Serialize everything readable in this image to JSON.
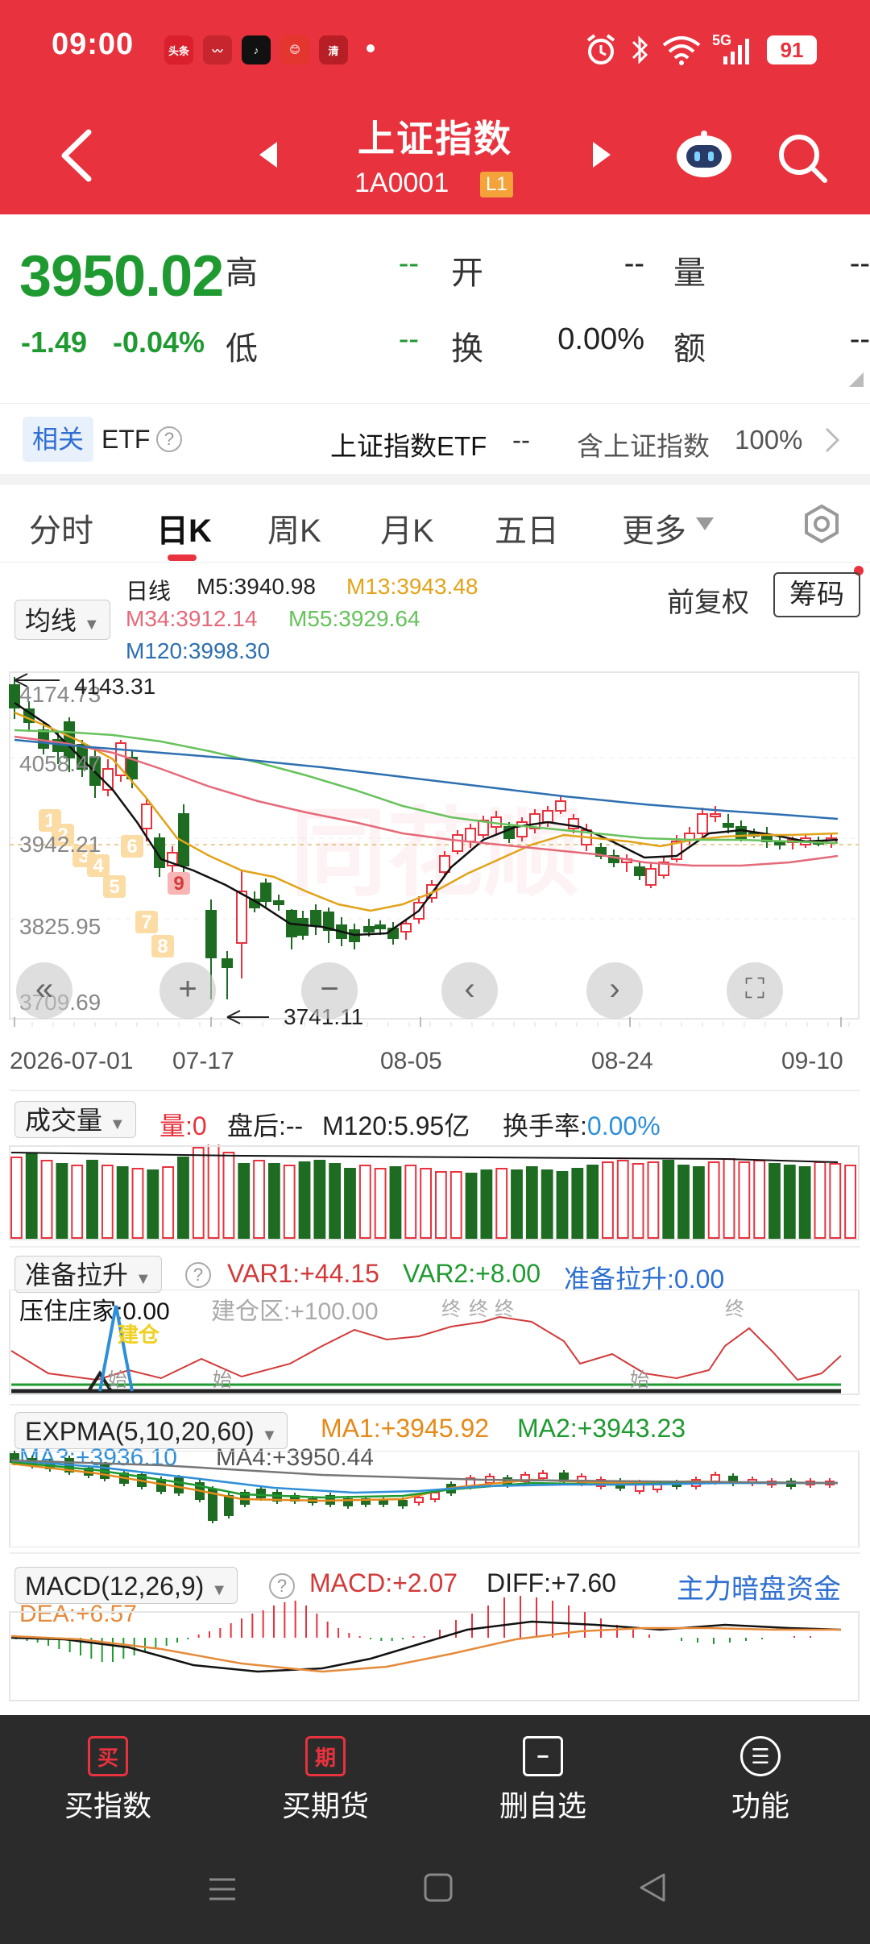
{
  "status_bar": {
    "time": "09:00",
    "battery": "91",
    "network": "5G",
    "app_icons": [
      {
        "label": "头条",
        "color": "#d9202c"
      },
      {
        "label": "〰",
        "color": "#c7262f"
      },
      {
        "label": "♪",
        "color": "#111111"
      },
      {
        "label": "😊",
        "color": "#e5352f"
      },
      {
        "label": "清",
        "color": "#b81e26"
      }
    ]
  },
  "header": {
    "title": "上证指数",
    "code": "1A0001",
    "level_badge": "L1"
  },
  "quote": {
    "price": "3950.02",
    "change": "-1.49",
    "change_pct": "-0.04%",
    "labels": {
      "high": "高",
      "open": "开",
      "volume": "量",
      "low": "低",
      "turnover": "换",
      "amount": "额"
    },
    "high": "--",
    "open": "--",
    "volume": "--",
    "low": "--",
    "turnover": "0.00%",
    "amount": "--"
  },
  "related": {
    "tag": "相关",
    "type": "ETF",
    "etf_name": "上证指数ETF",
    "etf_value": "--",
    "contains": "含上证指数",
    "weight": "100%"
  },
  "tabs": [
    "分时",
    "日K",
    "周K",
    "月K",
    "五日",
    "更多"
  ],
  "active_tab": "日K",
  "kline": {
    "indicator_select": "均线",
    "period": "日线",
    "m5": "M5:3940.98",
    "m13": "M13:3943.48",
    "m34": "M34:3912.14",
    "m55": "M55:3929.64",
    "m120": "M120:3998.30",
    "adjust": "前复权",
    "chip_button": "筹码",
    "y_labels": [
      "4174.73",
      "4058.47",
      "3942.21",
      "3825.95",
      "3709.69"
    ],
    "high_mark": "4143.31",
    "low_mark": "3741.11",
    "dates": [
      "2026-07-01",
      "07-17",
      "08-05",
      "08-24",
      "09-10"
    ],
    "td_numbers": [
      "1",
      "2",
      "3",
      "4",
      "5",
      "6",
      "7",
      "8",
      "9"
    ],
    "controls": [
      "fast-back",
      "zoom-in",
      "zoom-out",
      "prev",
      "next",
      "fullscreen"
    ],
    "colors": {
      "up": "#e8323d",
      "down": "#1e6b22",
      "m5": "#111111",
      "m13": "#e2a31a",
      "m34": "#e56a7a",
      "m55": "#67c25c",
      "m120": "#2d6fb0"
    }
  },
  "volume_panel": {
    "select": "成交量",
    "qty_label": "量:",
    "qty_value": "0",
    "after_hours": "盘后:--",
    "m120": "M120:5.95亿",
    "turnover_label": "换手率:",
    "turnover_value": "0.00%"
  },
  "zb_panel": {
    "select": "准备拉升",
    "var1": "VAR1:+44.15",
    "var2": "VAR2:+8.00",
    "ready": "准备拉升:0.00",
    "pressure": "压住庄家:0.00",
    "build": "建仓区:+100.00",
    "mark_build": "建仓",
    "mark_start": "始",
    "mark_end": "终"
  },
  "expma_panel": {
    "select": "EXPMA(5,10,20,60)",
    "ma1": "MA1:+3945.92",
    "ma2": "MA2:+3943.23",
    "ma3": "MA3:+3936.10",
    "ma4": "MA4:+3950.44"
  },
  "macd_panel": {
    "select": "MACD(12,26,9)",
    "macd": "MACD:+2.07",
    "diff": "DIFF:+7.60",
    "dea": "DEA:+6.57",
    "link": "主力暗盘资金"
  },
  "bottom_bar": [
    {
      "icon": "买",
      "label": "买指数"
    },
    {
      "icon": "期",
      "label": "买期货"
    },
    {
      "icon": "−",
      "label": "删自选"
    },
    {
      "icon": "☰",
      "label": "功能"
    }
  ]
}
